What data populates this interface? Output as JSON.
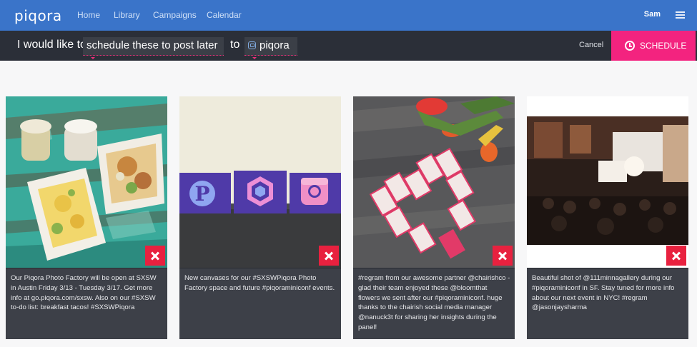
{
  "app": {
    "logo": "piqora"
  },
  "nav": {
    "links": [
      "Home",
      "Library",
      "Campaigns",
      "Calendar"
    ],
    "user": "Sam"
  },
  "action_bar": {
    "prefix": "I would like to",
    "action_value": "schedule these to post later",
    "connector": "to",
    "destination_value": "piqora",
    "cancel_label": "Cancel",
    "schedule_label": "SCHEDULE"
  },
  "cards": [
    {
      "caption": "Our Piqora Photo Factory will be open at SXSW in Austin Friday 3/13 - Tuesday 3/17. Get more info at go.piqora.com/sxsw. Also on our #SXSW to-do list: breakfast tacos! #SXSWPiqora"
    },
    {
      "caption": "New canvases for our #SXSWPiqora Photo Factory space and future #piqoraminiconf events."
    },
    {
      "caption": "#regram from our awesome partner @chairishco - glad their team enjoyed these @bloomthat flowers we sent after our #piqoraminiconf. huge thanks to the chairish social media manager @nanuck3t for sharing her insights during the panel!"
    },
    {
      "caption": "Beautiful shot of @111minnagallery during our #piqoraminiconf in SF. Stay tuned for more info about our next event in NYC! #regram @jasonjaysharma"
    }
  ],
  "colors": {
    "nav_bg": "#3a74c9",
    "action_bar_bg": "#2b2f38",
    "schedule_bg": "#f3237f",
    "remove_bg": "#e8213f",
    "caption_bg": "#3d4048"
  }
}
